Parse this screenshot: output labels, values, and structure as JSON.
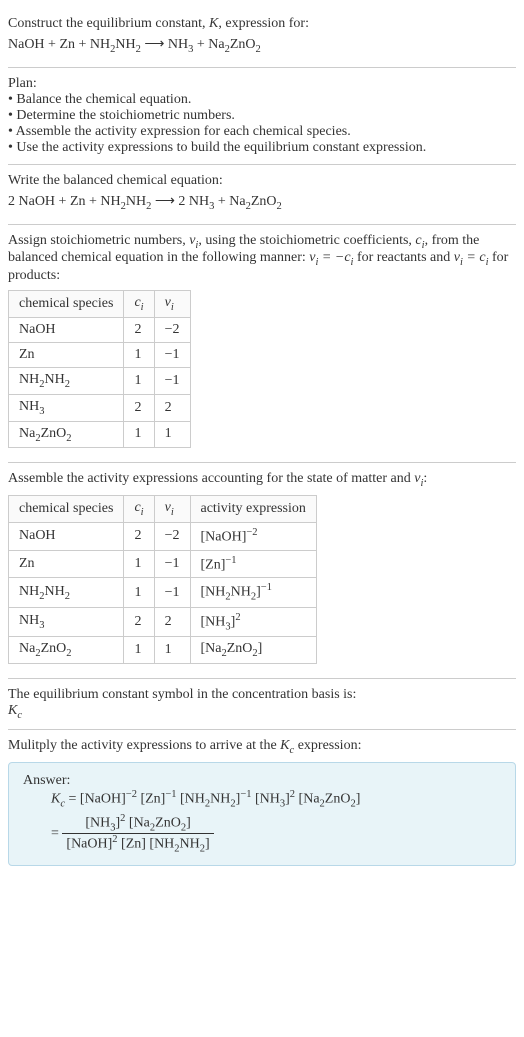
{
  "intro": {
    "line1": "Construct the equilibrium constant, ",
    "Ksym": "K",
    "line1b": ", expression for:",
    "reaction_lhs": "NaOH + Zn + NH",
    "reaction_rhs": " ⟶ NH",
    "plus_na2zno2": " + Na",
    "zno2": "ZnO"
  },
  "plan": {
    "heading": "Plan:",
    "b1": "• Balance the chemical equation.",
    "b2": "• Determine the stoichiometric numbers.",
    "b3": "• Assemble the activity expression for each chemical species.",
    "b4": "• Use the activity expressions to build the equilibrium constant expression."
  },
  "balanced": {
    "heading": "Write the balanced chemical equation:",
    "eq_a": "2 NaOH + Zn + NH",
    "eq_b": " ⟶ 2 NH",
    "eq_c": " + Na",
    "eq_d": "ZnO"
  },
  "assign": {
    "text_a": "Assign stoichiometric numbers, ",
    "nu": "ν",
    "text_b": ", using the stoichiometric coefficients, ",
    "ci": "c",
    "text_c": ", from the balanced chemical equation in the following manner: ",
    "rel1a": "ν",
    "rel1b": " = −c",
    "text_d": " for reactants and ",
    "rel2a": "ν",
    "rel2b": " = c",
    "text_e": " for products:"
  },
  "table1": {
    "h1": "chemical species",
    "h2": "c",
    "h3": "ν",
    "rows": [
      {
        "sp": "NaOH",
        "c": "2",
        "v": "−2"
      },
      {
        "sp": "Zn",
        "c": "1",
        "v": "−1"
      },
      {
        "sp": "NH2NH2",
        "c": "1",
        "v": "−1"
      },
      {
        "sp": "NH3",
        "c": "2",
        "v": "2"
      },
      {
        "sp": "Na2ZnO2",
        "c": "1",
        "v": "1"
      }
    ]
  },
  "assemble": {
    "text_a": "Assemble the activity expressions accounting for the state of matter and ",
    "nu": "ν",
    "text_b": ":"
  },
  "table2": {
    "h1": "chemical species",
    "h2": "c",
    "h3": "ν",
    "h4": "activity expression",
    "rows": [
      {
        "sp": "NaOH",
        "c": "2",
        "v": "−2",
        "ax": "[NaOH]",
        "exp": "−2"
      },
      {
        "sp": "Zn",
        "c": "1",
        "v": "−1",
        "ax": "[Zn]",
        "exp": "−1"
      },
      {
        "sp": "NH2NH2",
        "c": "1",
        "v": "−1",
        "ax": "[NH2NH2]",
        "exp": "−1"
      },
      {
        "sp": "NH3",
        "c": "2",
        "v": "2",
        "ax": "[NH3]",
        "exp": "2"
      },
      {
        "sp": "Na2ZnO2",
        "c": "1",
        "v": "1",
        "ax": "[Na2ZnO2]",
        "exp": ""
      }
    ]
  },
  "kc_symbol": {
    "line": "The equilibrium constant symbol in the concentration basis is:",
    "sym": "K",
    "sub": "c"
  },
  "multiply": {
    "line_a": "Mulitply the activity expressions to arrive at the ",
    "k": "K",
    "ksub": "c",
    "line_b": " expression:"
  },
  "answer": {
    "label": "Answer:",
    "kc": "K",
    "kcsub": "c",
    "eq": " = [NaOH]",
    "e_m2": "−2",
    "zn": " [Zn]",
    "e_m1": "−1",
    "nh2nh2": " [NH",
    "nh2nh2b": "NH",
    "nh2nh2c": "]",
    "nh3": " [NH",
    "nh3b": "]",
    "e_2": "2",
    "na2zno2": " [Na",
    "na2zno2b": "ZnO",
    "na2zno2c": "]",
    "num_a": "[NH",
    "num_b": "]",
    "num_c": " [Na",
    "num_d": "ZnO",
    "num_e": "]",
    "den_a": "[NaOH]",
    "den_b": " [Zn] [NH",
    "den_c": "NH",
    "den_d": "]",
    "equals": " = "
  },
  "chart_data": {
    "type": "table",
    "tables": [
      {
        "title": "Stoichiometric numbers",
        "columns": [
          "chemical species",
          "c_i",
          "ν_i"
        ],
        "rows": [
          [
            "NaOH",
            2,
            -2
          ],
          [
            "Zn",
            1,
            -1
          ],
          [
            "NH2NH2",
            1,
            -1
          ],
          [
            "NH3",
            2,
            2
          ],
          [
            "Na2ZnO2",
            1,
            1
          ]
        ]
      },
      {
        "title": "Activity expressions",
        "columns": [
          "chemical species",
          "c_i",
          "ν_i",
          "activity expression"
        ],
        "rows": [
          [
            "NaOH",
            2,
            -2,
            "[NaOH]^-2"
          ],
          [
            "Zn",
            1,
            -1,
            "[Zn]^-1"
          ],
          [
            "NH2NH2",
            1,
            -1,
            "[NH2NH2]^-1"
          ],
          [
            "NH3",
            2,
            2,
            "[NH3]^2"
          ],
          [
            "Na2ZnO2",
            1,
            1,
            "[Na2ZnO2]"
          ]
        ]
      }
    ]
  }
}
